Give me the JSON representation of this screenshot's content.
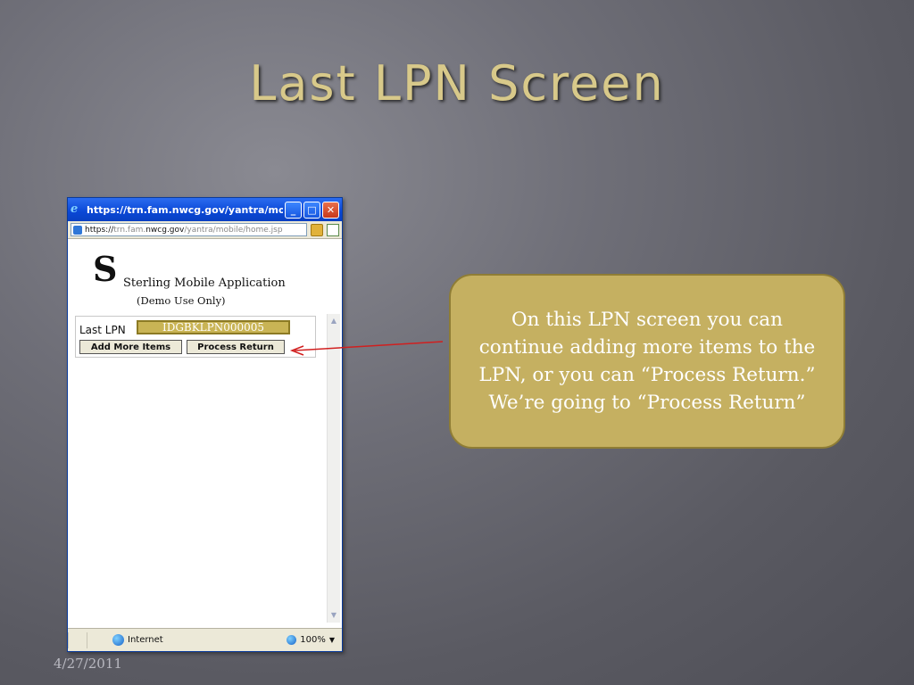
{
  "slide": {
    "title": "Last LPN Screen",
    "date": "4/27/2011"
  },
  "browser": {
    "window_title": "https://trn.fam.nwcg.gov/yantra/mob...",
    "address_prefix": "https://",
    "address_host": "trn.fam.",
    "address_domain": "nwcg.gov",
    "address_path": "/yantra/mobile/home.jsp",
    "status_zone": "Internet",
    "zoom": "100%"
  },
  "app": {
    "logo": "S",
    "name": "Sterling Mobile Application",
    "subtitle": "(Demo Use Only)",
    "last_lpn_label": "Last LPN",
    "last_lpn_value": "IDGBKLPN000005",
    "add_more_items_label": "Add More Items",
    "process_return_label": "Process Return"
  },
  "callout": {
    "text": "On this LPN screen you can continue adding more items to the LPN, or you can “Process Return.” We’re going to “Process Return”"
  },
  "colors": {
    "callout_fill": "#c5b061",
    "title_color": "#d8c98a",
    "arrow_color": "#d11f1f"
  },
  "icons": [
    "ie-logo-icon",
    "minimize-icon",
    "maximize-icon",
    "close-icon",
    "lock-icon",
    "page-icon",
    "globe-icon",
    "scroll-up-icon",
    "scroll-down-icon"
  ]
}
